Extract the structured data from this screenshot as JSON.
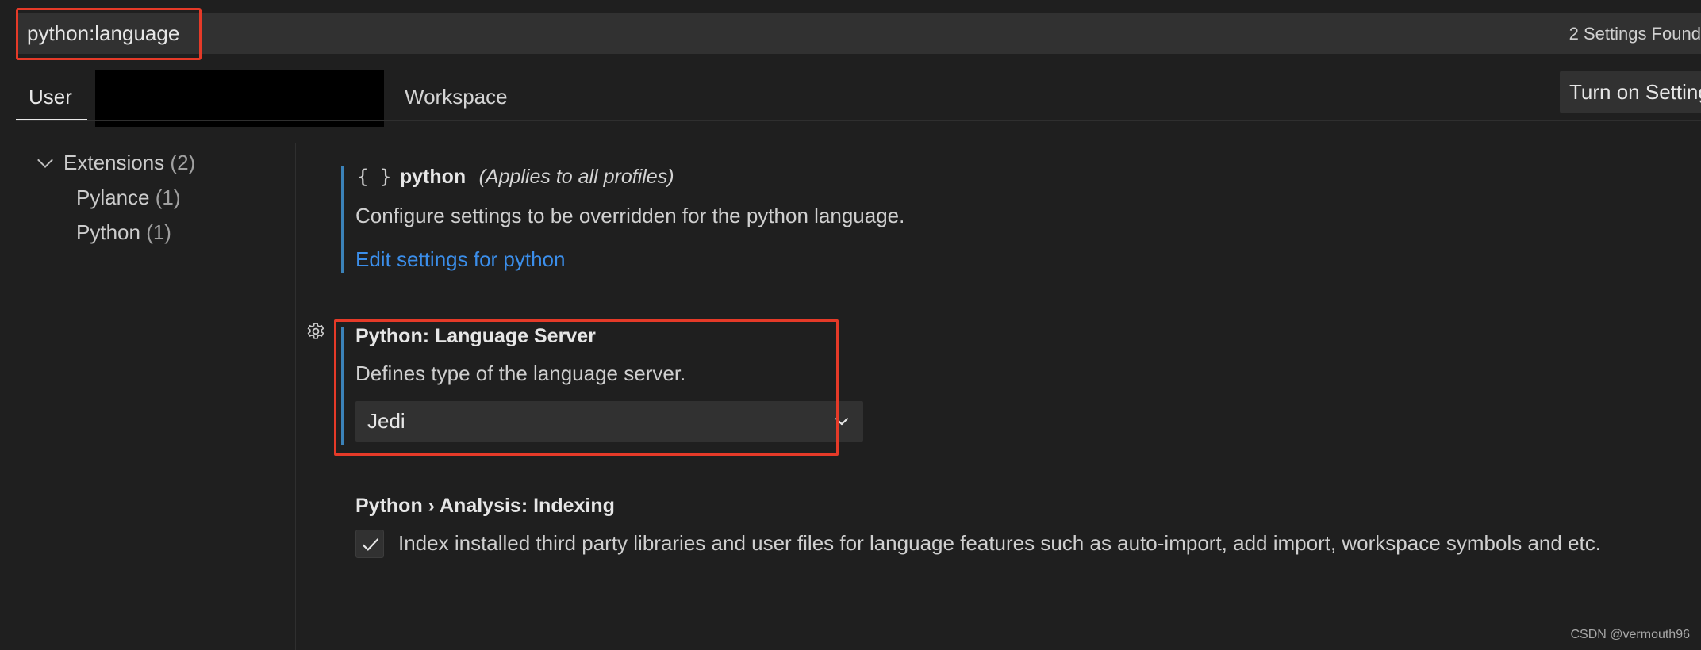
{
  "search": {
    "value": "python:language",
    "results_label": "2 Settings Found"
  },
  "scope_tabs": {
    "user": "User",
    "workspace": "Workspace"
  },
  "sync_button_label": "Turn on Settings Sync",
  "toc": {
    "group": {
      "label": "Extensions",
      "count": "(2)"
    },
    "items": [
      {
        "label": "Pylance",
        "count": "(1)"
      },
      {
        "label": "Python",
        "count": "(1)"
      }
    ]
  },
  "language_override": {
    "braces": "{ }",
    "name": "python",
    "scope_note": "(Applies to all profiles)",
    "description": "Configure settings to be overridden for the python language.",
    "link": "Edit settings for python"
  },
  "setting_language_server": {
    "title": "Python: Language Server",
    "description": "Defines type of the language server.",
    "selected_value": "Jedi"
  },
  "setting_indexing": {
    "title": "Python › Analysis: Indexing",
    "description": "Index installed third party libraries and user files for language features such as auto-import, add import, workspace symbols and etc.",
    "checked": true
  },
  "watermark": "CSDN @vermouth96",
  "colors": {
    "background": "#1f1f1f",
    "input_background": "#313131",
    "accent_bar": "#3b82b8",
    "link": "#3b8eea",
    "highlight": "#e53a28"
  },
  "icons": {
    "settings_gear": "gear-icon",
    "dropdown": "chevron-down-icon",
    "checkbox": "check-icon",
    "tree_toggle": "chevron-down-icon"
  }
}
